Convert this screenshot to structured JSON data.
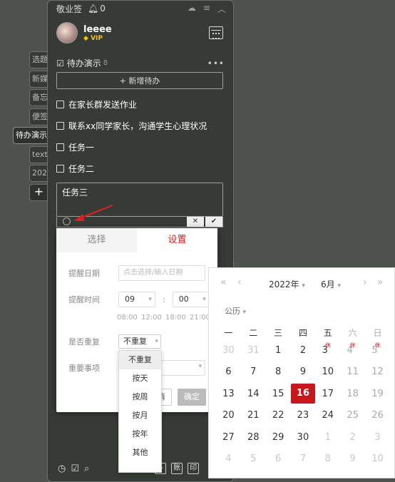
{
  "sidebar": {
    "tabs": [
      "选题",
      "新媒",
      "备忘",
      "便签",
      "待办演示",
      "text",
      "2022"
    ],
    "add": "+"
  },
  "titlebar": {
    "app": "敬业签",
    "bell_count": "0"
  },
  "user": {
    "name": "leeee",
    "badge": "VIP"
  },
  "list": {
    "title": "待办演示",
    "count": "8",
    "more": "•••",
    "add_label": "+ 新增待办",
    "items": [
      "在家长群发送作业",
      "联系xx同学家长，沟通学生心理状况",
      "任务一",
      "任务二"
    ],
    "editing": "任务三",
    "cancel": "✕",
    "confirm": "✔"
  },
  "bottom": {
    "b1": "账",
    "b2": "印"
  },
  "popup": {
    "tabs": [
      "选择",
      "设置"
    ],
    "date_label": "提醒日期",
    "date_placeholder": "点击选择/输入日期",
    "time_label": "提醒时间",
    "hour": "09",
    "minute": "00",
    "quick": [
      "08:00",
      "12:00",
      "18:00",
      "21:00"
    ],
    "repeat_label": "是否重复",
    "repeat_value": "不重复",
    "important_label": "重要事项",
    "cancel": "消",
    "ok": "确定",
    "repeat_options": [
      "不重复",
      "按天",
      "按周",
      "按月",
      "按年",
      "其他"
    ]
  },
  "calendar": {
    "year": "2022年",
    "month": "6月",
    "type": "公历",
    "weekdays": [
      "一",
      "二",
      "三",
      "四",
      "五",
      "六",
      "日"
    ],
    "holiday_mark": "休",
    "rows": [
      [
        "30",
        "31",
        "1",
        "2",
        "3",
        "4",
        "5"
      ],
      [
        "6",
        "7",
        "8",
        "9",
        "10",
        "11",
        "12"
      ],
      [
        "13",
        "14",
        "15",
        "16",
        "17",
        "18",
        "19"
      ],
      [
        "20",
        "21",
        "22",
        "23",
        "24",
        "25",
        "26"
      ],
      [
        "27",
        "28",
        "29",
        "30",
        "1",
        "2",
        "3"
      ],
      [
        "4",
        "5",
        "6",
        "7",
        "8",
        "9",
        "10"
      ]
    ],
    "today": "16"
  }
}
